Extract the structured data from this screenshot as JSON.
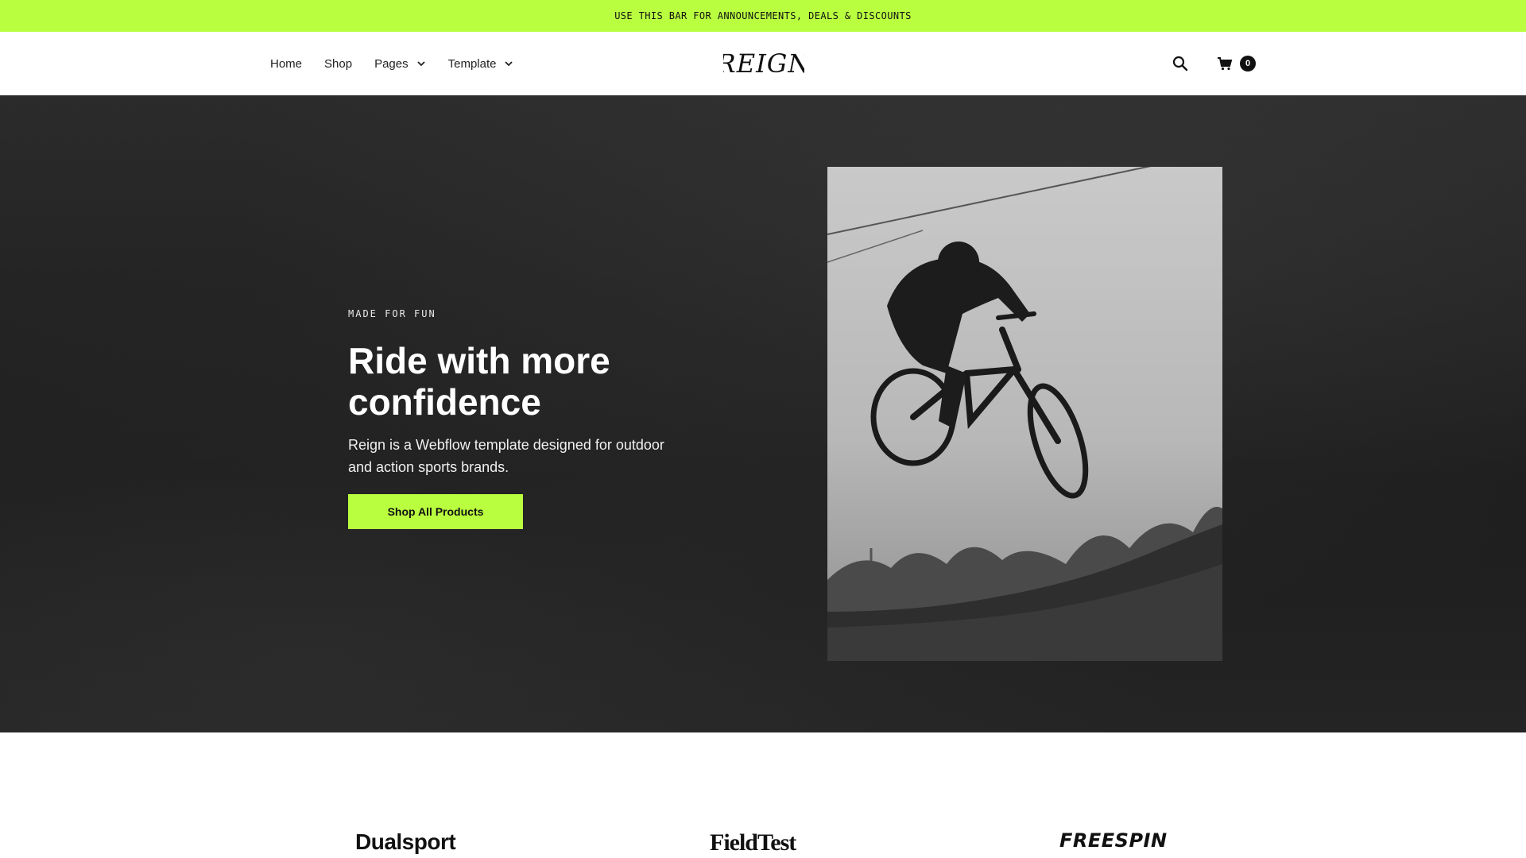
{
  "announcement": "USE THIS BAR FOR ANNOUNCEMENTS, DEALS & DISCOUNTS",
  "nav": {
    "items": [
      {
        "label": "Home",
        "dropdown": false
      },
      {
        "label": "Shop",
        "dropdown": false
      },
      {
        "label": "Pages",
        "dropdown": true
      },
      {
        "label": "Template",
        "dropdown": true
      }
    ]
  },
  "logo": {
    "text": "REIGN"
  },
  "header": {
    "search_icon": "search-icon",
    "cart_icon": "cart-icon",
    "cart_count": "0"
  },
  "hero": {
    "eyebrow": "MADE FOR FUN",
    "title": "Ride with more confidence",
    "description": "Reign is a Webflow template designed for outdoor and action sports brands.",
    "cta_label": "Shop All Products"
  },
  "brands": [
    "Dualsport",
    "FieldTest",
    "FREESPIN"
  ],
  "colors": {
    "accent": "#b9ff40",
    "hero_bg": "#222222",
    "text_dark": "#111111"
  }
}
